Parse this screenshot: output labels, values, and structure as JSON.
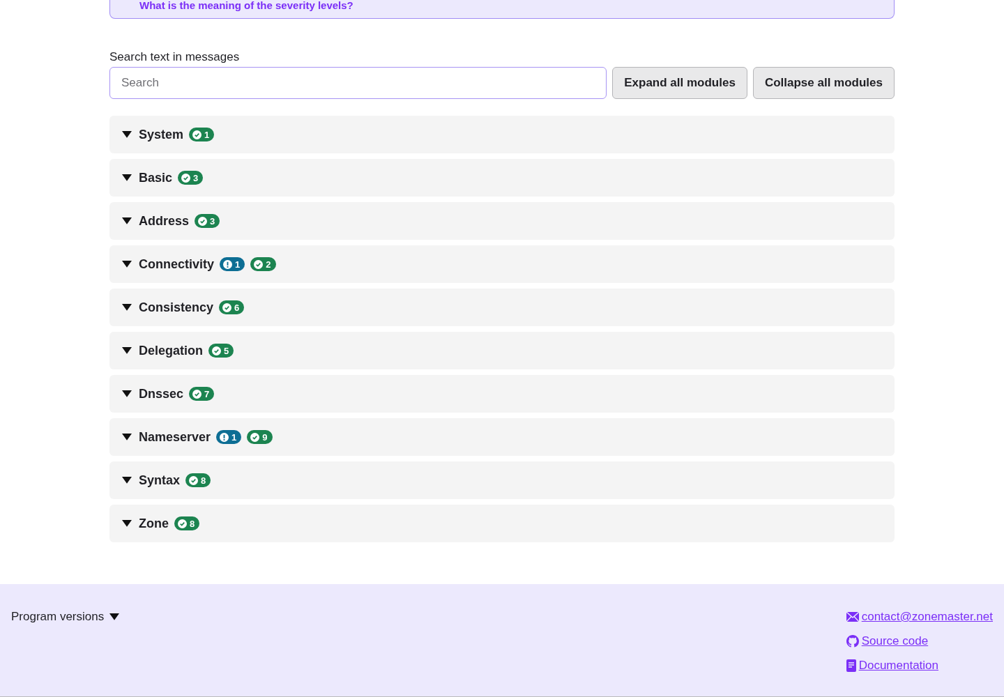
{
  "faq_link": "What is the meaning of the severity levels?",
  "search": {
    "label": "Search text in messages",
    "placeholder": "Search"
  },
  "buttons": [
    "Expand all modules",
    "Collapse all modules"
  ],
  "modules": [
    {
      "name": "System",
      "expanded": false,
      "badges": [
        {
          "kind": "info",
          "count": "1"
        }
      ]
    },
    {
      "name": "Basic",
      "expanded": false,
      "badges": [
        {
          "kind": "info",
          "count": "3"
        }
      ]
    },
    {
      "name": "Address",
      "expanded": false,
      "badges": [
        {
          "kind": "info",
          "count": "3"
        }
      ]
    },
    {
      "name": "Connectivity",
      "expanded": false,
      "badges": [
        {
          "kind": "notice",
          "count": "1"
        },
        {
          "kind": "info",
          "count": "2"
        }
      ]
    },
    {
      "name": "Consistency",
      "expanded": false,
      "badges": [
        {
          "kind": "info",
          "count": "6"
        }
      ]
    },
    {
      "name": "Delegation",
      "expanded": false,
      "badges": [
        {
          "kind": "info",
          "count": "5"
        }
      ]
    },
    {
      "name": "Dnssec",
      "expanded": false,
      "badges": [
        {
          "kind": "info",
          "count": "7"
        }
      ]
    },
    {
      "name": "Nameserver",
      "expanded": false,
      "badges": [
        {
          "kind": "notice",
          "count": "1"
        },
        {
          "kind": "info",
          "count": "9"
        }
      ]
    },
    {
      "name": "Syntax",
      "expanded": false,
      "badges": [
        {
          "kind": "info",
          "count": "8"
        }
      ]
    },
    {
      "name": "Zone",
      "expanded": false,
      "badges": [
        {
          "kind": "info",
          "count": "8"
        }
      ]
    }
  ],
  "footer": {
    "versions": {
      "label": "Program versions",
      "expanded": false
    },
    "links": [
      {
        "kind": "mail",
        "label": "contact@zonemaster.net"
      },
      {
        "kind": "github",
        "label": "Source code"
      },
      {
        "kind": "doc",
        "label": "Documentation"
      }
    ]
  }
}
